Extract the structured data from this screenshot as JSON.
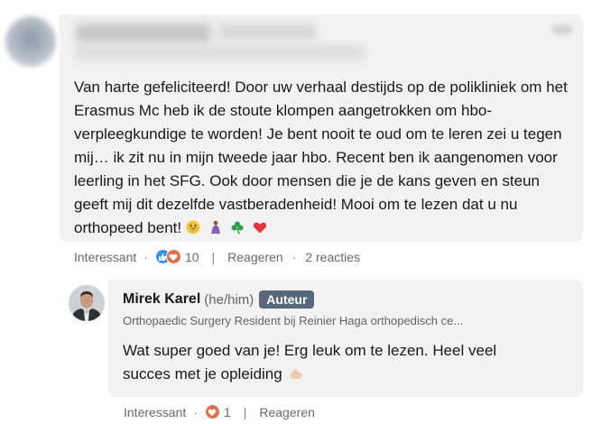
{
  "comment": {
    "text": "Van harte gefeliciteerd! Door uw verhaal destijds op de polikliniek om het Erasmus Mc heb ik de stoute klompen aangetrokken om hbo-verpleegkundige te worden! Je bent nooit te oud om te leren zei u tegen mij… ik zit nu in mijn tweede jaar hbo. Recent ben ik aangenomen voor leerling in het SFG. Ook door mensen die je de kans geven en steun geeft mij dit dezelfde vastberadenheid! Mooi om te lezen dat u nu orthopeed bent!",
    "emojis": [
      "grinning-face-icon",
      "person-praying-icon",
      "shamrock-icon",
      "red-heart-icon"
    ],
    "actions": {
      "interesting": "Interessant",
      "reactions_count": "10",
      "reply": "Reageren",
      "replies": "2 reacties"
    }
  },
  "reply": {
    "author": "Mirek Karel",
    "pronouns": "(he/him)",
    "badge": "Auteur",
    "headline": "Orthopaedic Surgery Resident bij Reinier Haga orthopedisch ce...",
    "text": "Wat super goed van je! Erg leuk om te lezen. Heel veel succes met je opleiding",
    "emoji": "flexed-biceps-icon",
    "actions": {
      "interesting": "Interessant",
      "reactions_count": "1",
      "reply": "Reageren"
    }
  },
  "colors": {
    "bubble": "#f2f2f2",
    "badge": "#56687a",
    "like": "#378fe9",
    "love": "#df704d"
  }
}
